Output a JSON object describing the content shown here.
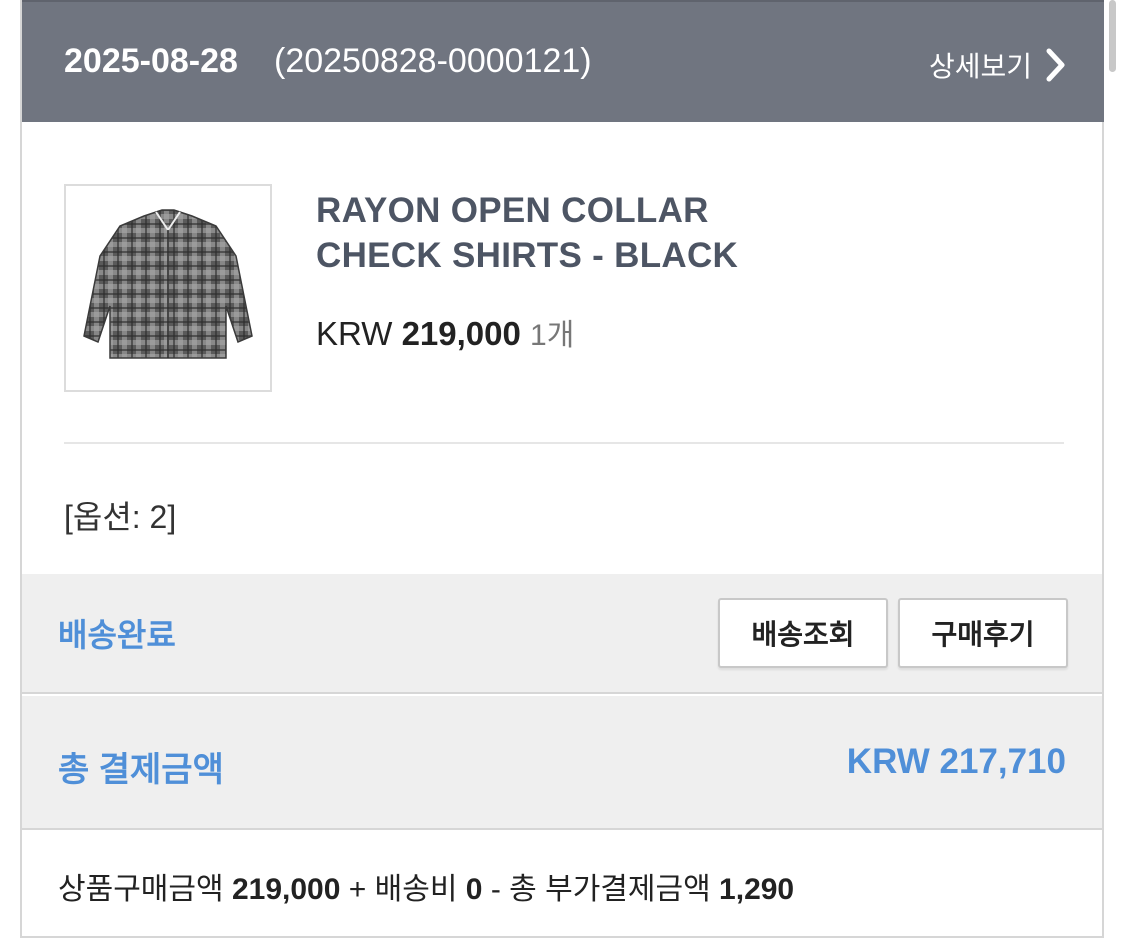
{
  "order": {
    "date": "2025-08-28",
    "number": "(20250828-0000121)",
    "detail_label": "상세보기"
  },
  "product": {
    "image_icon": "plaid-shirt-thumbnail",
    "name_line1": "RAYON OPEN COLLAR",
    "name_line2": "CHECK SHIRTS - BLACK",
    "currency": "KRW",
    "price": "219,000",
    "quantity": "1개",
    "option": "[옵션: 2]"
  },
  "status": {
    "label": "배송완료",
    "track_button": "배송조회",
    "review_button": "구매후기"
  },
  "total": {
    "label": "총 결제금액",
    "amount": "KRW 217,710"
  },
  "breakdown": {
    "product_label": "상품구매금액",
    "product_amount": "219,000",
    "plus": "+",
    "shipping_label": "배송비",
    "shipping_amount": "0",
    "minus": "-",
    "extra_label": "총 부가결제금액",
    "extra_amount": "1,290"
  },
  "colors": {
    "header_bg": "#707580",
    "accent_blue": "#4f8fd8",
    "product_title": "#4d5564"
  }
}
